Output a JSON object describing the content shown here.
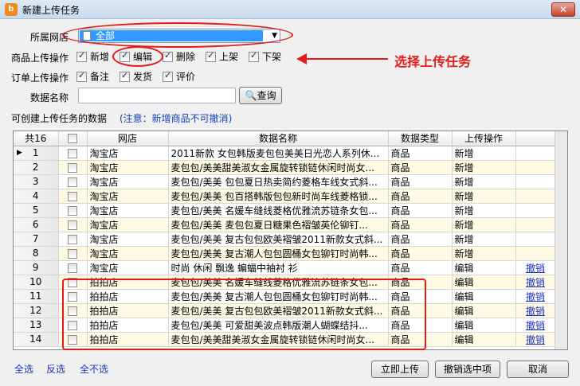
{
  "window": {
    "title": "新建上传任务",
    "close_label": "✕"
  },
  "store_label": "所属网店",
  "store_combo": {
    "value": "全部"
  },
  "product_ops": {
    "label": "商品上传操作",
    "items": [
      {
        "label": "新增",
        "checked": true
      },
      {
        "label": "编辑",
        "checked": true
      },
      {
        "label": "删除",
        "checked": true
      },
      {
        "label": "上架",
        "checked": true
      },
      {
        "label": "下架",
        "checked": true
      }
    ]
  },
  "order_ops": {
    "label": "订单上传操作",
    "items": [
      {
        "label": "备注",
        "checked": true
      },
      {
        "label": "发货",
        "checked": true
      },
      {
        "label": "评价",
        "checked": true
      }
    ]
  },
  "annotation": "选择上传任务",
  "data_name": {
    "label": "数据名称",
    "value": "",
    "query_label": "查询"
  },
  "data_section": {
    "label": "可创建上传任务的数据",
    "notice": "(注意：新增商品不可撤消)"
  },
  "table": {
    "headers": [
      "共16",
      "",
      "网店",
      "数据名称",
      "数据类型",
      "上传操作"
    ],
    "rows": [
      [
        "1",
        "淘宝店",
        "2011新款 女包韩版麦包包美美日光恋人系列休...",
        "商品",
        "新增",
        ""
      ],
      [
        "2",
        "淘宝店",
        "麦包包/美美甜美淑女金属旋转锁链休闲时尚女...",
        "商品",
        "新增",
        ""
      ],
      [
        "3",
        "淘宝店",
        "麦包包/美美 包包夏日热卖简约菱格车线女式斜...",
        "商品",
        "新增",
        ""
      ],
      [
        "4",
        "淘宝店",
        "麦包包/美美 包百搭韩版包包新时尚车线菱格锁...",
        "商品",
        "新增",
        ""
      ],
      [
        "5",
        "淘宝店",
        "麦包包/美美 名媛车缝线菱格优雅流苏链条女包...",
        "商品",
        "新增",
        ""
      ],
      [
        "6",
        "淘宝店",
        "麦包包/美美 麦包包夏日糖果色褶皱英伦铆钉...",
        "商品",
        "新增",
        ""
      ],
      [
        "7",
        "淘宝店",
        "麦包包/美美 复古包包欧美褶皱2011新款女式斜...",
        "商品",
        "新增",
        ""
      ],
      [
        "8",
        "淘宝店",
        "麦包包/美美 复古潮人包包圆桶女包铆钉时尚韩...",
        "商品",
        "新增",
        ""
      ],
      [
        "9",
        "淘宝店",
        "时尚 休闲 飘逸 蝙蝠中袖衬 衫",
        "商品",
        "编辑",
        "撤销"
      ],
      [
        "10",
        "拍拍店",
        "麦包包/美美 名媛车缝线菱格优雅流苏链条女包...",
        "商品",
        "编辑",
        "撤销"
      ],
      [
        "11",
        "拍拍店",
        "麦包包/美美 复古潮人包包圆桶女包铆钉时尚韩...",
        "商品",
        "编辑",
        "撤销"
      ],
      [
        "12",
        "拍拍店",
        "麦包包/美美 复古包包欧美褶皱2011新款女式斜...",
        "商品",
        "编辑",
        "撤销"
      ],
      [
        "13",
        "拍拍店",
        "麦包包/美美 可爱甜美波点韩版潮人蝴蝶结抖...",
        "商品",
        "编辑",
        "撤销"
      ],
      [
        "14",
        "拍拍店",
        "麦包包/美美甜美淑女金属旋转锁链休闲时尚女...",
        "商品",
        "编辑",
        "撤销"
      ]
    ]
  },
  "footer": {
    "select_all": "全选",
    "invert": "反选",
    "select_none": "全不选",
    "upload_now": "立即上传",
    "cancel_selected": "撤销选中项",
    "cancel": "取消"
  }
}
